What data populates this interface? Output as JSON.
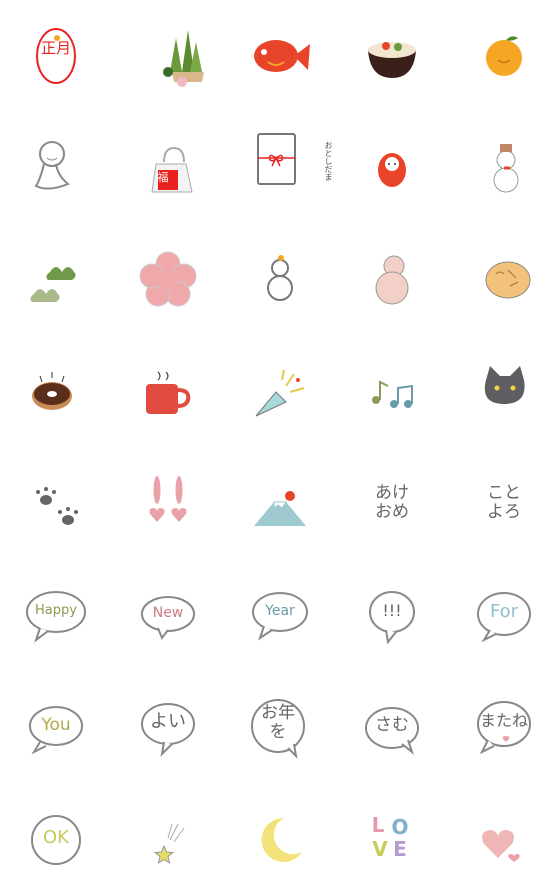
{
  "stickers": {
    "shogatsu": "正月",
    "fuku": "福",
    "otoshidama": "おとしだま",
    "akeome": "あけ\nおめ",
    "kotoyoro": "こと\nよろ",
    "happy": "Happy",
    "new": "New",
    "year": "Year",
    "exclaim": "!!!",
    "for": "For",
    "you": "You",
    "yoi": "よい",
    "otoshio": "お年\nを",
    "samu": "さむ",
    "matane": "またね",
    "ok": "OK",
    "love_l": "L",
    "love_o": "O",
    "love_v": "V",
    "love_e": "E"
  },
  "colors": {
    "red": "#e8231f",
    "orange": "#f5a623",
    "gray": "#888888",
    "pink": "#e9a3a8"
  }
}
